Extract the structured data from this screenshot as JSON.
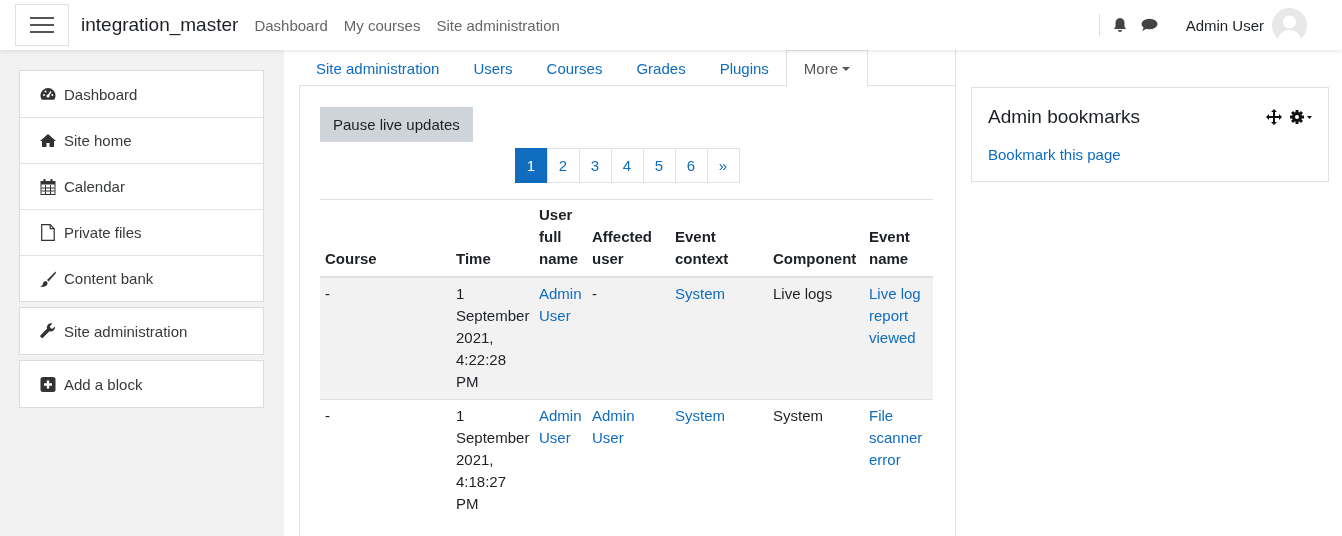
{
  "navbar": {
    "site_name": "integration_master",
    "links": [
      "Dashboard",
      "My courses",
      "Site administration"
    ],
    "user_name": "Admin User"
  },
  "sidebar": {
    "groups": [
      [
        "Dashboard",
        "Site home",
        "Calendar",
        "Private files",
        "Content bank"
      ],
      [
        "Site administration"
      ],
      [
        "Add a block"
      ]
    ]
  },
  "tabs": [
    {
      "label": "Site administration",
      "selected": false
    },
    {
      "label": "Users",
      "selected": false
    },
    {
      "label": "Courses",
      "selected": false
    },
    {
      "label": "Grades",
      "selected": false
    },
    {
      "label": "Plugins",
      "selected": false
    },
    {
      "label": "More",
      "selected": true
    }
  ],
  "pause_button": "Pause live updates",
  "pagination": [
    {
      "label": "1",
      "selected": true
    },
    {
      "label": "2",
      "selected": false
    },
    {
      "label": "3",
      "selected": false
    },
    {
      "label": "4",
      "selected": false
    },
    {
      "label": "5",
      "selected": false
    },
    {
      "label": "6",
      "selected": false
    },
    {
      "label": "»",
      "selected": false
    }
  ],
  "table": {
    "columns": [
      "Course",
      "Time",
      "User full name",
      "Affected user",
      "Event context",
      "Component",
      "Event name"
    ],
    "rows": [
      {
        "highlighted": true,
        "cells": [
          {
            "text": "-",
            "link": false
          },
          {
            "text": "1 September 2021, 4:22:28 PM",
            "link": false
          },
          {
            "text": "Admin User",
            "link": true
          },
          {
            "text": "-",
            "link": false
          },
          {
            "text": "System",
            "link": true
          },
          {
            "text": "Live logs",
            "link": false
          },
          {
            "text": "Live log report viewed",
            "link": true
          }
        ]
      },
      {
        "highlighted": false,
        "cells": [
          {
            "text": "-",
            "link": false
          },
          {
            "text": "1 September 2021, 4:18:27 PM",
            "link": false
          },
          {
            "text": "Admin User",
            "link": true
          },
          {
            "text": "Admin User",
            "link": true
          },
          {
            "text": "System",
            "link": true
          },
          {
            "text": "System",
            "link": false
          },
          {
            "text": "File scanner error",
            "link": true
          }
        ]
      }
    ]
  },
  "bookmarks_block": {
    "title": "Admin bookmarks",
    "link": "Bookmark this page"
  }
}
